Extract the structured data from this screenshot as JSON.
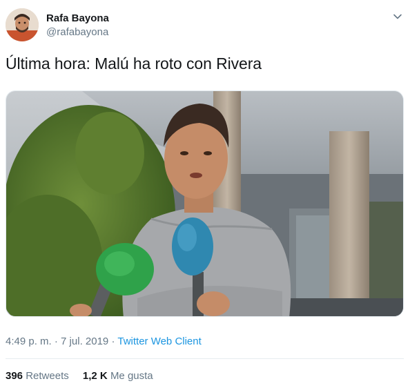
{
  "user": {
    "display_name": "Rafa Bayona",
    "handle": "@rafabayona",
    "avatar_icon": "user-avatar"
  },
  "tweet": {
    "text": "Última hora: Malú ha roto con Rivera",
    "time": "4:49 p. m.",
    "separator": "·",
    "date": "7 jul. 2019",
    "source": "Twitter Web Client"
  },
  "stats": {
    "retweets_count": "396",
    "retweets_label": "Retweets",
    "likes_count": "1,2 K",
    "likes_label": "Me gusta"
  },
  "colors": {
    "link": "#1b95e0",
    "secondary_text": "#657786",
    "primary_text": "#14171a"
  },
  "icons": {
    "menu": "chevron-down-icon"
  }
}
